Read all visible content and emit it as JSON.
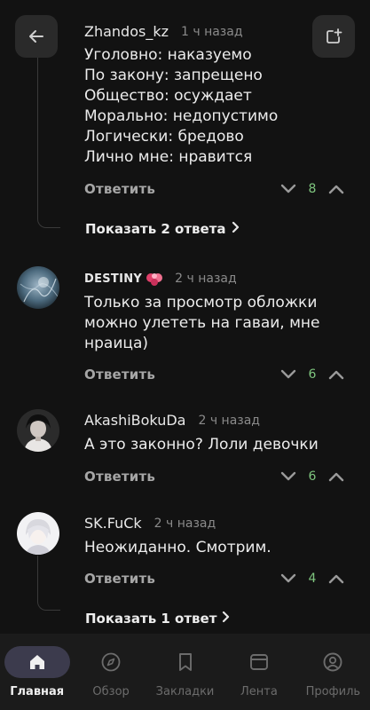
{
  "top_buttons": {
    "back_icon": "arrow-left-icon",
    "add_icon": "add-to-collection-icon"
  },
  "comments": [
    {
      "author": "Zhandos_kz",
      "time": "1 ч назад",
      "lines": [
        "Уголовно: наказуемо",
        "По закону: запрещено",
        "Общество: осуждает",
        "Морально: недопустимо",
        "Логически: бредово",
        "Лично мне: нравится"
      ],
      "reply_label": "Ответить",
      "votes": "8",
      "show_replies": "Показать 2 ответа"
    },
    {
      "author": "DESTINY",
      "time": "2 ч назад",
      "lines": [
        "Только за просмотр обложки",
        "можно улететь на гаваи, мне",
        "нраица)"
      ],
      "reply_label": "Ответить",
      "votes": "6"
    },
    {
      "author": "AkashiBokuDa",
      "time": "2 ч назад",
      "lines": [
        "А это законно? Лоли девочки"
      ],
      "reply_label": "Ответить",
      "votes": "6"
    },
    {
      "author": "SK.FuCk",
      "time": "2 ч назад",
      "lines": [
        "Неожиданно. Смотрим."
      ],
      "reply_label": "Ответить",
      "votes": "4",
      "show_replies": "Показать 1 ответ"
    }
  ],
  "nav": [
    {
      "label": "Главная",
      "icon": "home-icon",
      "active": true
    },
    {
      "label": "Обзор",
      "icon": "compass-icon",
      "active": false
    },
    {
      "label": "Закладки",
      "icon": "bookmark-icon",
      "active": false
    },
    {
      "label": "Лента",
      "icon": "feed-icon",
      "active": false
    },
    {
      "label": "Профиль",
      "icon": "profile-icon",
      "active": false
    }
  ],
  "colors": {
    "background": "#121212",
    "vote_green": "#7fc67f",
    "nav_active_pill": "#3c3b4d"
  }
}
